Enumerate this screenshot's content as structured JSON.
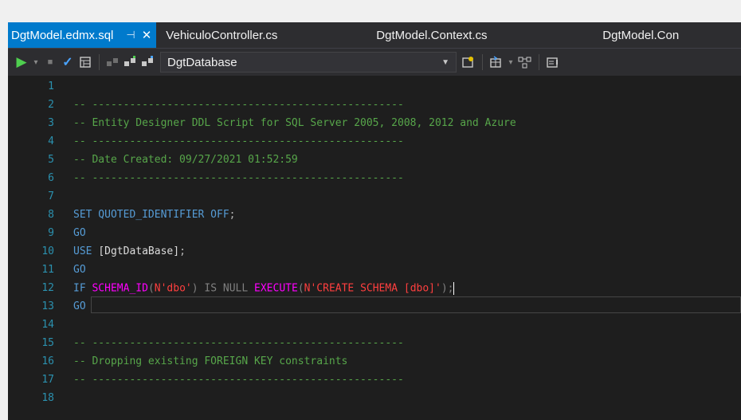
{
  "tabs": [
    {
      "label": "DgtModel.edmx.sql",
      "active": true,
      "pin": "⊣",
      "close": "✕"
    },
    {
      "label": "VehiculoController.cs",
      "active": false
    },
    {
      "label": "DgtModel.Context.cs",
      "active": false
    },
    {
      "label": "DgtModel.Con",
      "active": false
    }
  ],
  "toolbar": {
    "database": "DgtDatabase"
  },
  "editor": {
    "lines": [
      {
        "n": "1",
        "tokens": []
      },
      {
        "n": "2",
        "tokens": [
          {
            "t": "-- --------------------------------------------------",
            "c": "comment"
          }
        ]
      },
      {
        "n": "3",
        "tokens": [
          {
            "t": "-- Entity Designer DDL Script for SQL Server 2005, 2008, 2012 and Azure",
            "c": "comment"
          }
        ]
      },
      {
        "n": "4",
        "tokens": [
          {
            "t": "-- --------------------------------------------------",
            "c": "comment"
          }
        ]
      },
      {
        "n": "5",
        "tokens": [
          {
            "t": "-- Date Created: 09/27/2021 01:52:59",
            "c": "comment"
          }
        ]
      },
      {
        "n": "6",
        "tokens": [
          {
            "t": "-- --------------------------------------------------",
            "c": "comment"
          }
        ]
      },
      {
        "n": "7",
        "tokens": []
      },
      {
        "n": "8",
        "tokens": [
          {
            "t": "SET QUOTED_IDENTIFIER OFF",
            "c": "kw"
          },
          {
            "t": ";",
            "c": "punct"
          }
        ]
      },
      {
        "n": "9",
        "tokens": [
          {
            "t": "GO",
            "c": "kw"
          }
        ]
      },
      {
        "n": "10",
        "tokens": [
          {
            "t": "USE ",
            "c": "kw"
          },
          {
            "t": "[DgtDataBase]",
            "c": "ident"
          },
          {
            "t": ";",
            "c": "punct"
          }
        ]
      },
      {
        "n": "11",
        "tokens": [
          {
            "t": "GO",
            "c": "kw"
          }
        ]
      },
      {
        "n": "12",
        "current": true,
        "tokens": [
          {
            "t": "IF ",
            "c": "kw"
          },
          {
            "t": "SCHEMA_ID",
            "c": "func"
          },
          {
            "t": "(",
            "c": "grey"
          },
          {
            "t": "N'dbo'",
            "c": "strred"
          },
          {
            "t": ") ",
            "c": "grey"
          },
          {
            "t": "IS NULL ",
            "c": "grey"
          },
          {
            "t": "EXECUTE",
            "c": "func"
          },
          {
            "t": "(",
            "c": "grey"
          },
          {
            "t": "N'CREATE SCHEMA [dbo]'",
            "c": "strred"
          },
          {
            "t": ");",
            "c": "grey"
          }
        ]
      },
      {
        "n": "13",
        "tokens": [
          {
            "t": "GO",
            "c": "kw"
          }
        ]
      },
      {
        "n": "14",
        "tokens": []
      },
      {
        "n": "15",
        "tokens": [
          {
            "t": "-- --------------------------------------------------",
            "c": "comment"
          }
        ]
      },
      {
        "n": "16",
        "tokens": [
          {
            "t": "-- Dropping existing FOREIGN KEY constraints",
            "c": "comment"
          }
        ]
      },
      {
        "n": "17",
        "tokens": [
          {
            "t": "-- --------------------------------------------------",
            "c": "comment"
          }
        ]
      },
      {
        "n": "18",
        "tokens": []
      }
    ]
  }
}
